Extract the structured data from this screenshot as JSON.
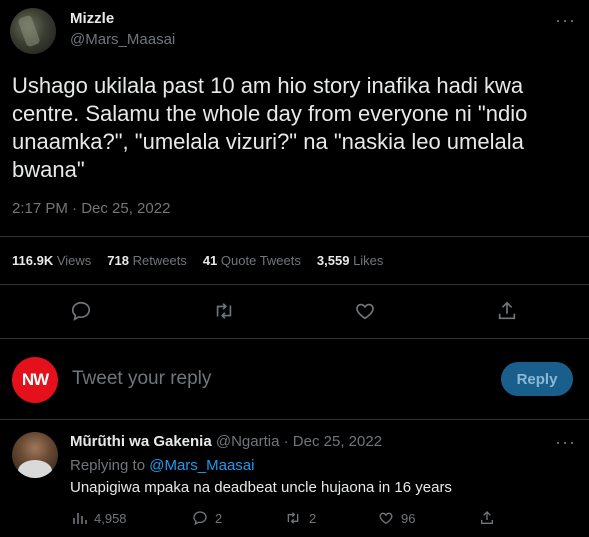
{
  "main_tweet": {
    "author_name": "Mizzle",
    "author_handle": "@Mars_Maasai",
    "text": "Ushago ukilala past 10 am hio story inafika hadi kwa centre. Salamu the whole day from everyone ni \"ndio unaamka?\", \"umelala vizuri?\" na \"naskia leo umelala bwana\"",
    "timestamp": "2:17 PM · Dec 25, 2022",
    "more": "···",
    "stats": {
      "views_count": "116.9K",
      "views_label": "Views",
      "retweets_count": "718",
      "retweets_label": "Retweets",
      "quotes_count": "41",
      "quotes_label": "Quote Tweets",
      "likes_count": "3,559",
      "likes_label": "Likes"
    }
  },
  "compose": {
    "avatar_text": "NW",
    "placeholder": "Tweet your reply",
    "button_label": "Reply"
  },
  "reply_tweet": {
    "author_name": "Mũrũthi wa Gakenia",
    "author_handle": "@Ngartia",
    "date": "· Dec 25, 2022",
    "more": "···",
    "replying_label": "Replying to",
    "replying_handle": "@Mars_Maasai",
    "text": "Unapigiwa mpaka na deadbeat uncle hujaona in 16 years",
    "views": "4,958",
    "replies": "2",
    "retweets": "2",
    "likes": "96"
  },
  "colors": {
    "background": "#000000",
    "text": "#e7e9ea",
    "muted": "#71767b",
    "accent": "#1d9bf0",
    "nw_badge": "#e4101b"
  },
  "icons": [
    "more-icon",
    "reply-icon",
    "retweet-icon",
    "like-icon",
    "share-icon",
    "views-icon"
  ]
}
